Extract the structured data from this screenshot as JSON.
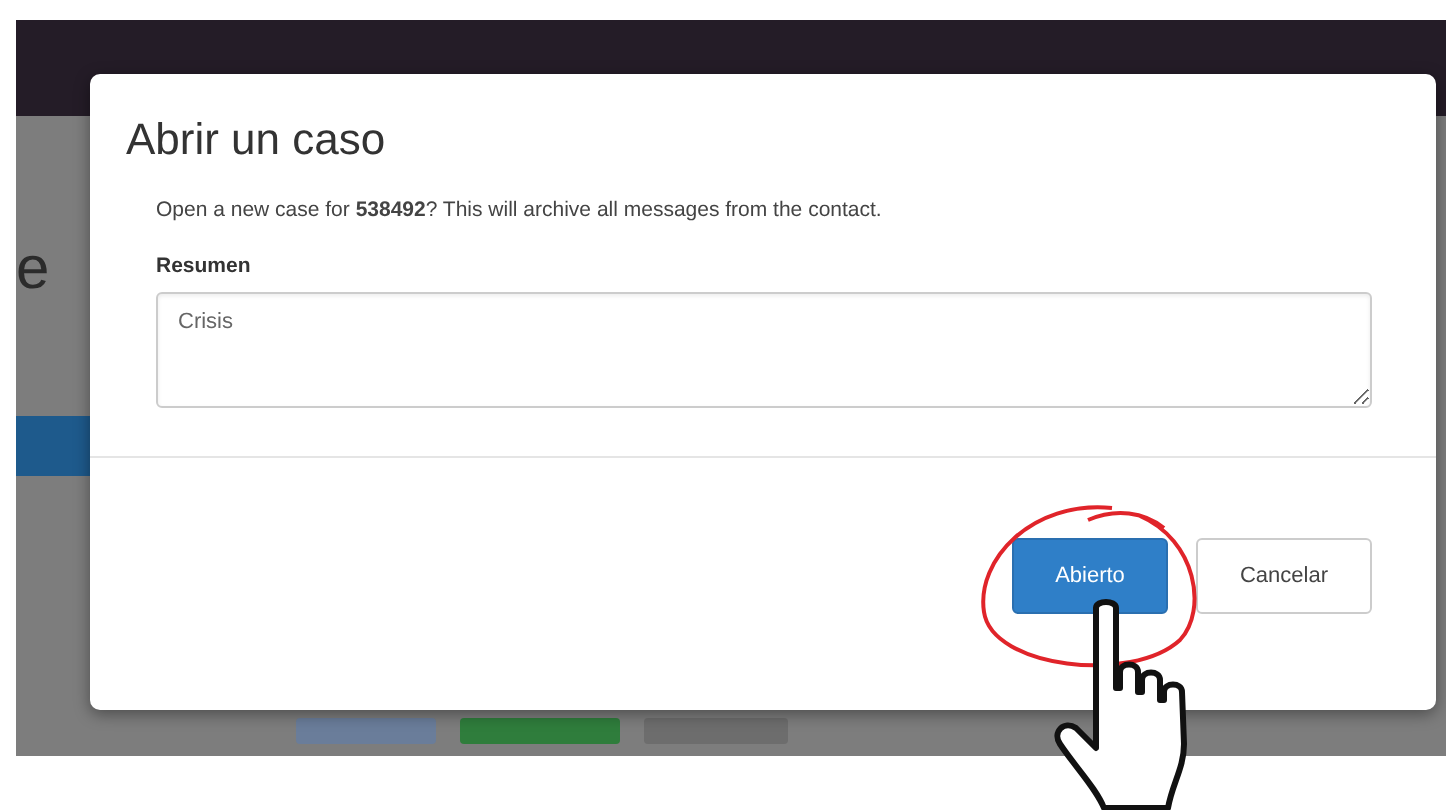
{
  "background": {
    "heading_fragment": "e"
  },
  "dialog": {
    "title": "Abrir un caso",
    "message": "Open a new case for **538492**? This will archive all messages from the contact.",
    "field": {
      "label": "Resumen",
      "value": "Crisis"
    },
    "buttons": [
      {
        "label": "Abierto",
        "kind": "primary"
      },
      {
        "label": "Cancelar",
        "kind": "secondary"
      }
    ]
  }
}
